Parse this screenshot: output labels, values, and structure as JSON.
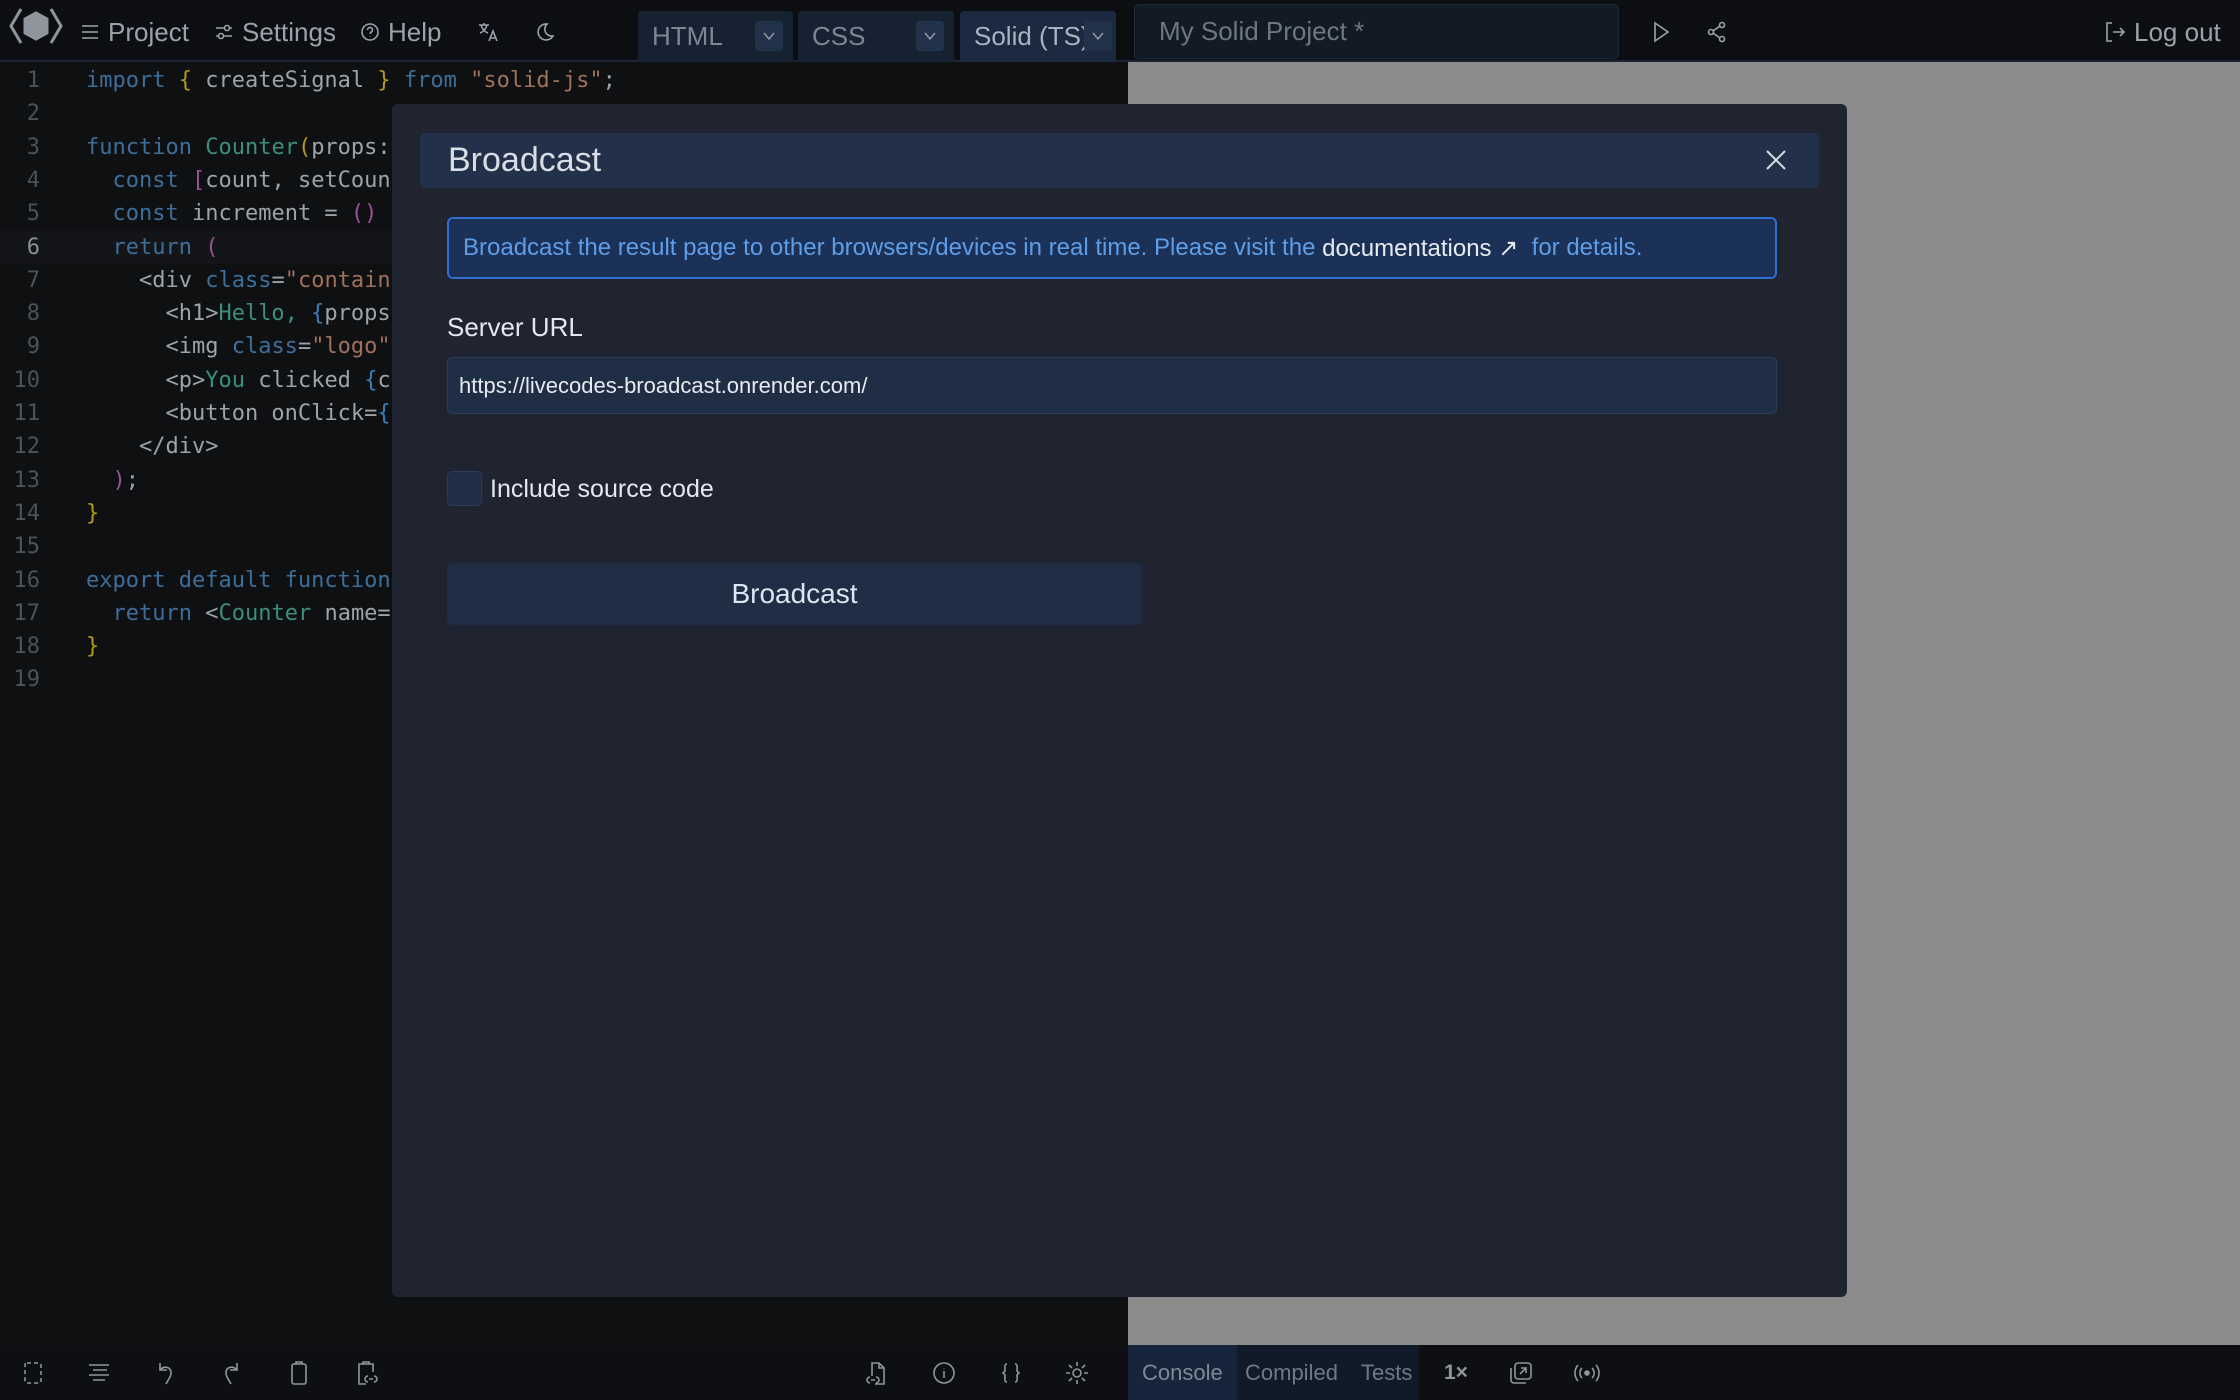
{
  "header": {
    "menu": {
      "project": "Project",
      "settings": "Settings",
      "help": "Help"
    },
    "tabs": [
      {
        "label": "HTML"
      },
      {
        "label": "CSS"
      },
      {
        "label": "Solid (TS)"
      }
    ],
    "project_title": "My Solid Project  *",
    "logout": "Log out"
  },
  "editor": {
    "current_line": 6,
    "lines": [
      [
        [
          "import",
          "kw"
        ],
        [
          " "
        ],
        [
          "{",
          "br1"
        ],
        [
          " createSignal "
        ],
        [
          "}",
          "br1"
        ],
        [
          " "
        ],
        [
          "from",
          "kw"
        ],
        [
          " "
        ],
        [
          "\"solid-js\"",
          "str"
        ],
        [
          ";"
        ]
      ],
      [],
      [
        [
          "function",
          "kw"
        ],
        [
          " "
        ],
        [
          "Counter",
          "fn"
        ],
        [
          "(",
          "br1"
        ],
        [
          "props:"
        ]
      ],
      [
        [
          "  "
        ],
        [
          "const",
          "kw"
        ],
        [
          " "
        ],
        [
          "[",
          "br2"
        ],
        [
          "count, setCoun"
        ]
      ],
      [
        [
          "  "
        ],
        [
          "const",
          "kw"
        ],
        [
          " increment = "
        ],
        [
          "()",
          "br2"
        ],
        [
          " "
        ]
      ],
      [
        [
          "  "
        ],
        [
          "return",
          "kw"
        ],
        [
          " "
        ],
        [
          "(",
          "br2"
        ]
      ],
      [
        [
          "    <div "
        ],
        [
          "class",
          "attr"
        ],
        [
          "="
        ],
        [
          "\"contain",
          "str"
        ]
      ],
      [
        [
          "      <h1>"
        ],
        [
          "Hello, ",
          "jsx"
        ],
        [
          "{",
          "br3"
        ],
        [
          "props"
        ]
      ],
      [
        [
          "      <img "
        ],
        [
          "class",
          "attr"
        ],
        [
          "="
        ],
        [
          "\"logo\"",
          "str"
        ]
      ],
      [
        [
          "      <p>"
        ],
        [
          "You",
          "jsx"
        ],
        [
          " clicked "
        ],
        [
          "{",
          "br3"
        ],
        [
          "c"
        ]
      ],
      [
        [
          "      <button onClick="
        ],
        [
          "{",
          "br3"
        ]
      ],
      [
        [
          "    </div>"
        ]
      ],
      [
        [
          "  "
        ],
        [
          ")",
          "br2"
        ],
        [
          ";"
        ]
      ],
      [
        [
          "}",
          "br1"
        ]
      ],
      [],
      [
        [
          "export default function",
          "kw"
        ]
      ],
      [
        [
          "  "
        ],
        [
          "return",
          "kw"
        ],
        [
          " <"
        ],
        [
          "Counter",
          "fn"
        ],
        [
          " name="
        ]
      ],
      [
        [
          "}",
          "br1"
        ]
      ],
      []
    ]
  },
  "modal": {
    "title": "Broadcast",
    "info_before": "Broadcast the result page to other browsers/devices in real time. Please visit the ",
    "info_link": "documentations ↗",
    "info_after": "  for details.",
    "server_url_label": "Server URL",
    "server_url_value": "https://livecodes-broadcast.onrender.com/",
    "include_source_label": "Include source code",
    "include_source_checked": false,
    "broadcast_button": "Broadcast"
  },
  "toolsbar": {
    "console": "Console",
    "compiled": "Compiled",
    "tests": "Tests",
    "zoom": "1×"
  }
}
